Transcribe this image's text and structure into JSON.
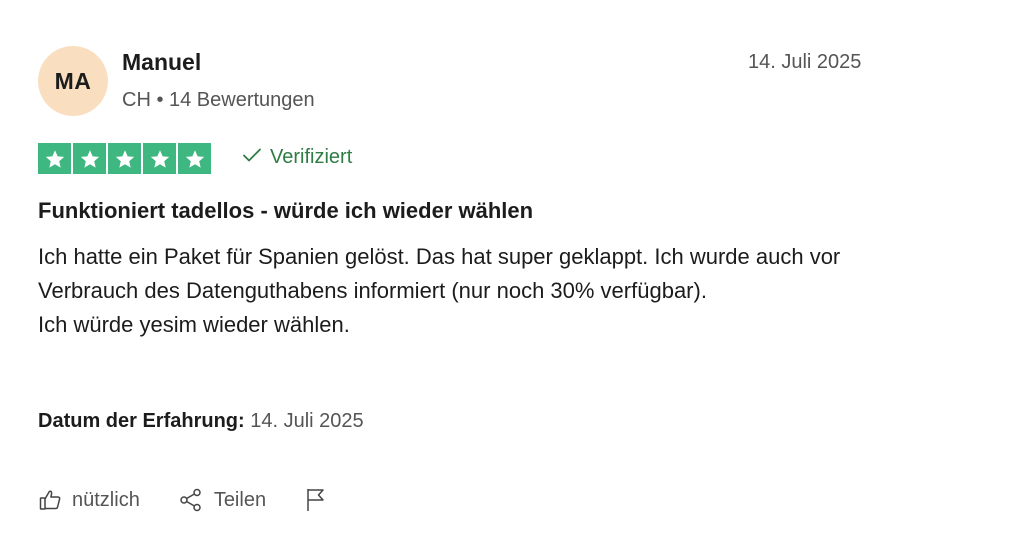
{
  "reviewer": {
    "initials": "MA",
    "name": "Manuel",
    "meta": "CH • 14 Bewertungen",
    "avatar_color": "#f9dfbf"
  },
  "review": {
    "date": "14. Juli 2025",
    "rating": 5,
    "rating_max": 5,
    "star_color": "#3eb780",
    "verified_label": "Verifiziert",
    "title": "Funktioniert tadellos - würde ich wieder wählen",
    "body": [
      "Ich hatte ein Paket für Spanien gelöst. Das hat super geklappt. Ich wurde auch vor Verbrauch des Datenguthabens informiert (nur noch 30% verfügbar).",
      "Ich würde yesim wieder wählen."
    ],
    "experience_label": "Datum der Erfahrung:",
    "experience_date": "14. Juli 2025"
  },
  "actions": {
    "useful_label": "nützlich",
    "useful_icon": "thumbs-up-icon",
    "share_label": "Teilen",
    "share_icon": "share-icon",
    "report_icon": "flag-icon"
  }
}
